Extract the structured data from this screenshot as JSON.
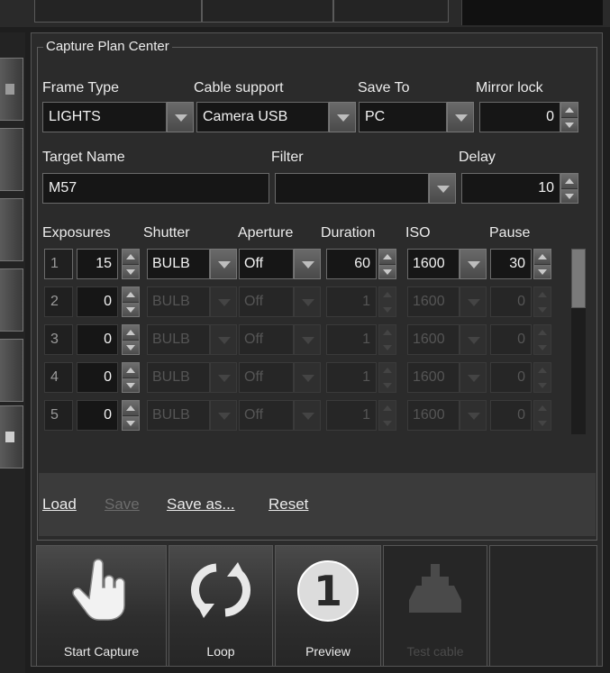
{
  "group_title": "Capture Plan Center",
  "row1": {
    "frame_type": {
      "label": "Frame Type",
      "value": "LIGHTS"
    },
    "cable_support": {
      "label": "Cable support",
      "value": "Camera USB"
    },
    "save_to": {
      "label": "Save To",
      "value": "PC"
    },
    "mirror_lock": {
      "label": "Mirror lock",
      "value": "0"
    }
  },
  "row2": {
    "target_name": {
      "label": "Target Name",
      "value": "M57"
    },
    "filter": {
      "label": "Filter",
      "value": ""
    },
    "delay": {
      "label": "Delay",
      "value": "10"
    }
  },
  "table": {
    "headers": [
      "Exposures",
      "Shutter",
      "Aperture",
      "Duration",
      "ISO",
      "Pause"
    ],
    "rows": [
      {
        "idx": "1",
        "exposures": "15",
        "shutter": "BULB",
        "aperture": "Off",
        "duration": "60",
        "iso": "1600",
        "pause": "30",
        "enabled": true
      },
      {
        "idx": "2",
        "exposures": "0",
        "shutter": "BULB",
        "aperture": "Off",
        "duration": "1",
        "iso": "1600",
        "pause": "0",
        "enabled": false
      },
      {
        "idx": "3",
        "exposures": "0",
        "shutter": "BULB",
        "aperture": "Off",
        "duration": "1",
        "iso": "1600",
        "pause": "0",
        "enabled": false
      },
      {
        "idx": "4",
        "exposures": "0",
        "shutter": "BULB",
        "aperture": "Off",
        "duration": "1",
        "iso": "1600",
        "pause": "0",
        "enabled": false
      },
      {
        "idx": "5",
        "exposures": "0",
        "shutter": "BULB",
        "aperture": "Off",
        "duration": "1",
        "iso": "1600",
        "pause": "0",
        "enabled": false
      }
    ]
  },
  "links": {
    "load": "Load",
    "save": "Save",
    "save_as": "Save as...",
    "reset": "Reset"
  },
  "toolbar": {
    "start_capture": "Start Capture",
    "loop": "Loop",
    "preview": "Preview",
    "test_cable": "Test cable",
    "preview_badge": "1"
  },
  "colors": {
    "background": "#2b2b2b",
    "field": "#161616",
    "border": "#6a6a6a",
    "disabled_text": "#555555"
  },
  "icons": [
    "hand-pointer-icon",
    "loop-arrows-icon",
    "preview-one-icon",
    "cable-icon"
  ]
}
